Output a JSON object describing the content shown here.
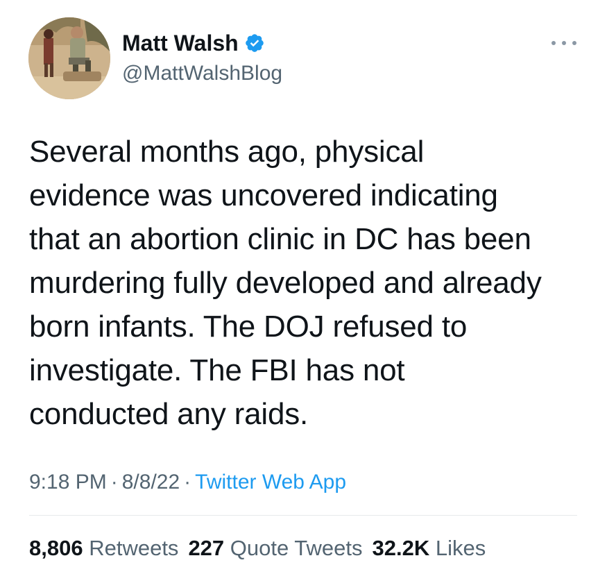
{
  "author": {
    "display_name": "Matt Walsh",
    "handle": "@MattWalshBlog",
    "verified_icon": "verified-badge-icon",
    "avatar_icon": "profile-photo"
  },
  "tweet": {
    "text": "Several months ago, physical\nevidence was uncovered indicating\nthat an abortion clinic in DC has been\nmurdering fully developed and already\nborn infants. The DOJ refused to\ninvestigate. The FBI has not\nconducted any raids.",
    "time": "9:18 PM",
    "separator": "·",
    "date": "8/8/22",
    "source": "Twitter Web App"
  },
  "stats": {
    "retweets_count": "8,806",
    "retweets_label": "Retweets",
    "quotes_count": "227",
    "quotes_label": "Quote Tweets",
    "likes_count": "32.2K",
    "likes_label": "Likes"
  },
  "colors": {
    "text": "#0f1419",
    "secondary": "#536471",
    "accent": "#1d9bf0",
    "divider": "#e6e9eb"
  }
}
